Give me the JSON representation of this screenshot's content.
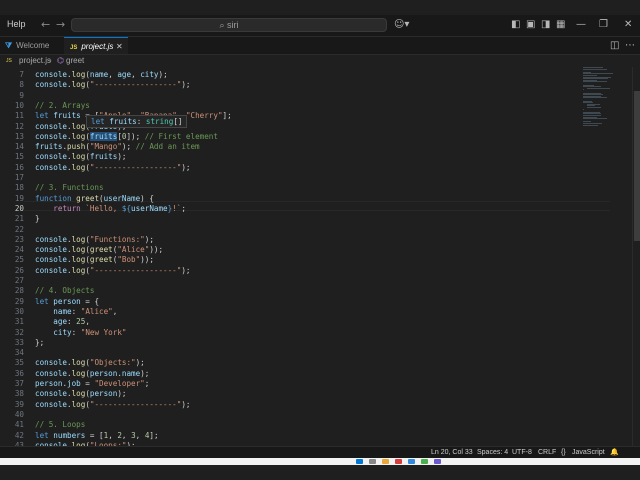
{
  "menu": {
    "help": "Help"
  },
  "search": {
    "text": "siri"
  },
  "tabs": [
    {
      "label": "Welcome",
      "icon": "vscode-icon"
    },
    {
      "label": "project.js",
      "icon": "JS"
    }
  ],
  "breadcrumb": {
    "file": "project.js",
    "symbol": "greet"
  },
  "hover": {
    "text": "let fruits: string[]"
  },
  "editor": {
    "current_line": 20,
    "lines": [
      {
        "n": "7",
        "text": "console.log(name, age, city);"
      },
      {
        "n": "8",
        "text": "console.log(\"------------------\");"
      },
      {
        "n": "9",
        "text": ""
      },
      {
        "n": "10",
        "text": "// 2. Arrays"
      },
      {
        "n": "11",
        "text": "let fruits = [\"Apple\", \"Banana\", \"Cherry\"];"
      },
      {
        "n": "12",
        "text": "console.log(fruits);"
      },
      {
        "n": "13",
        "text": "console.log(fruits[0]); // First element"
      },
      {
        "n": "14",
        "text": "fruits.push(\"Mango\"); // Add an item"
      },
      {
        "n": "15",
        "text": "console.log(fruits);"
      },
      {
        "n": "16",
        "text": "console.log(\"------------------\");"
      },
      {
        "n": "17",
        "text": ""
      },
      {
        "n": "18",
        "text": "// 3. Functions"
      },
      {
        "n": "19",
        "text": "function greet(userName) {"
      },
      {
        "n": "20",
        "text": "    return `Hello, ${userName}!`;"
      },
      {
        "n": "21",
        "text": "}"
      },
      {
        "n": "22",
        "text": ""
      },
      {
        "n": "23",
        "text": "console.log(\"Functions:\");"
      },
      {
        "n": "24",
        "text": "console.log(greet(\"Alice\"));"
      },
      {
        "n": "25",
        "text": "console.log(greet(\"Bob\"));"
      },
      {
        "n": "26",
        "text": "console.log(\"------------------\");"
      },
      {
        "n": "27",
        "text": ""
      },
      {
        "n": "28",
        "text": "// 4. Objects"
      },
      {
        "n": "29",
        "text": "let person = {"
      },
      {
        "n": "30",
        "text": "    name: \"Alice\","
      },
      {
        "n": "31",
        "text": "    age: 25,"
      },
      {
        "n": "32",
        "text": "    city: \"New York\""
      },
      {
        "n": "33",
        "text": "};"
      },
      {
        "n": "34",
        "text": ""
      },
      {
        "n": "35",
        "text": "console.log(\"Objects:\");"
      },
      {
        "n": "36",
        "text": "console.log(person.name);"
      },
      {
        "n": "37",
        "text": "person.job = \"Developer\";"
      },
      {
        "n": "38",
        "text": "console.log(person);"
      },
      {
        "n": "39",
        "text": "console.log(\"------------------\");"
      },
      {
        "n": "40",
        "text": ""
      },
      {
        "n": "41",
        "text": "// 5. Loops"
      },
      {
        "n": "42",
        "text": "let numbers = [1, 2, 3, 4];"
      },
      {
        "n": "43",
        "text": "console.log(\"Loops:\");"
      }
    ]
  },
  "status": {
    "position": "Ln 20, Col 33",
    "spaces": "Spaces: 4",
    "encoding": "UTF-8",
    "eol": "CRLF",
    "language": "JavaScript"
  },
  "colors": {
    "accent": "#0078d4",
    "background": "#1f1f1f",
    "keyword": "#569cd6",
    "string": "#ce9178",
    "comment": "#6a9955",
    "function": "#dcdcaa"
  }
}
